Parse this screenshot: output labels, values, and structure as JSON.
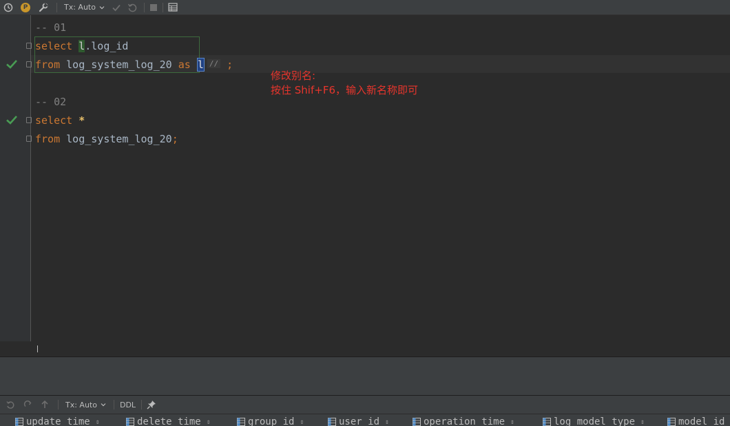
{
  "toolbar": {
    "tx_mode": "Tx: Auto",
    "icons": [
      "history-icon",
      "p-badge-icon",
      "wrench-icon",
      "commit-icon",
      "rollback-icon",
      "stop-icon",
      "table-icon"
    ],
    "p_badge": "P"
  },
  "editor": {
    "lines": {
      "c1": "-- 01",
      "q1_kw1": "select",
      "q1_alias": "l",
      "q1_rest": ".log_id",
      "q1_kw2": "from",
      "q1_table": " log_system_log_20 ",
      "q1_as": "as",
      "q1_alias2": "l",
      "q1_hint": "//",
      "q1_semi": ";",
      "c2": "-- 02",
      "q2_kw1": "select",
      "q2_star": "*",
      "q2_kw2": "from",
      "q2_table": " log_system_log_20",
      "q2_semi": ";"
    },
    "colors": {
      "keyword": "#cc7832",
      "comment": "#808080",
      "text": "#a9b7c6",
      "check": "#499c54",
      "annotation": "#e8352c"
    }
  },
  "annotation": {
    "line1": "修改别名:",
    "line2": "按住 Shif+F6，输入新名称即可"
  },
  "bottom_toolbar": {
    "tx_mode": "Tx: Auto",
    "ddl_label": "DDL",
    "icons": [
      "undo-icon",
      "redo-icon",
      "submit-icon",
      "pin-icon"
    ]
  },
  "columns": [
    "update_time",
    "delete_time",
    "group_id",
    "user_id",
    "operation_time",
    "log_model_type",
    "model_id"
  ]
}
